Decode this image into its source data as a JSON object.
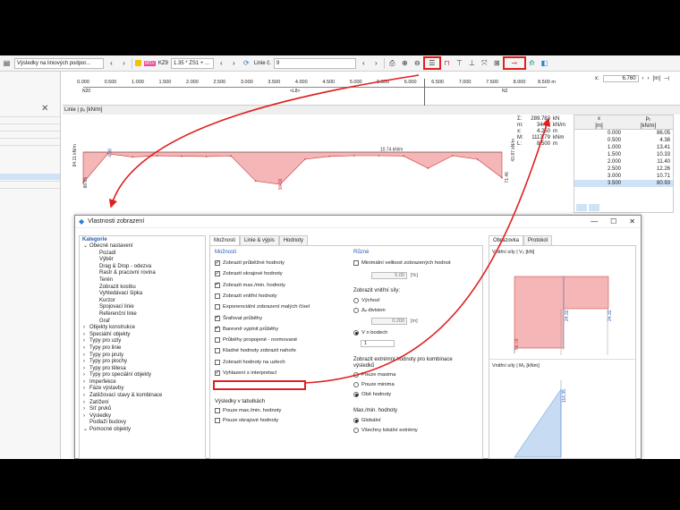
{
  "toolbar": {
    "results_combo": "Výsledky na liniových podpor...",
    "co_label": "MSV",
    "co_code": "KZ9",
    "co_value": "1.35 * ZS1 + ...",
    "line_label": "Linie č.",
    "line_value": "9"
  },
  "ruler": {
    "ticks": [
      "0.000",
      "0.500",
      "1.000",
      "1.500",
      "2.000",
      "2.500",
      "3.000",
      "3.500",
      "4.000",
      "4.500",
      "5.000",
      "5.500",
      "6.000",
      "6.500",
      "7.000",
      "7.500",
      "8.000",
      "8.500 m"
    ],
    "node_start": "N20",
    "node_end": "N2",
    "length_label": "<L8>",
    "x_label": "x:",
    "x_value": "6.760",
    "x_unit": "[m]"
  },
  "diagram_title": "Linie | p₂ [kN/m]",
  "summary": {
    "rows": [
      {
        "label": "Σ:",
        "value": "289.783",
        "unit": "kN"
      },
      {
        "label": "m:",
        "value": "34.09",
        "unit": "kN/m"
      },
      {
        "label": "x:",
        "value": "4.250",
        "unit": "m"
      },
      {
        "label": "M:",
        "value": "1117.79",
        "unit": "kNm"
      },
      {
        "label": "L:",
        "value": "8.500",
        "unit": "m"
      }
    ]
  },
  "value_table": {
    "col1_head": "x",
    "col1_unit": "[m]",
    "col2_head": "p₂",
    "col2_unit": "[kN/m]",
    "rows": [
      {
        "x": "0.000",
        "p": "86.05"
      },
      {
        "x": "0.500",
        "p": "4.38"
      },
      {
        "x": "1.000",
        "p": "13.41"
      },
      {
        "x": "1.500",
        "p": "10.33"
      },
      {
        "x": "2.000",
        "p": "11.40"
      },
      {
        "x": "2.500",
        "p": "12.26"
      },
      {
        "x": "3.000",
        "p": "10.71"
      },
      {
        "x": "3.500",
        "p": "80.93"
      }
    ]
  },
  "chart_data": {
    "type": "area",
    "title": "Linie | p₂ [kN/m]",
    "xlabel": "",
    "ylabel": "",
    "x": [
      0.0,
      0.5,
      1.0,
      1.5,
      2.0,
      2.5,
      3.0,
      3.5,
      4.0,
      4.5,
      5.0,
      5.5,
      6.0,
      6.5,
      7.0,
      7.5,
      8.0,
      8.5
    ],
    "series": [
      {
        "values": [
          86.05,
          4.38,
          13.41,
          10.33,
          11.4,
          12.26,
          10.71,
          80.93,
          90.36,
          20.0,
          12.0,
          10.0,
          10.0,
          10.74,
          45.0,
          10.0,
          20.0,
          71.46
        ]
      }
    ],
    "annotations": [
      "84.11 kN/m",
      "86.05",
      "4.38",
      "90.36",
      "10.74 kN/m",
      "43.87 kN/m",
      "71.46"
    ],
    "xlim": [
      0,
      8.5
    ]
  },
  "dialog": {
    "title": "Vlastnosti zobrazení",
    "category_header": "Kategorie",
    "categories": [
      {
        "label": "Obecné nastavení",
        "level": 0,
        "exp": "⌄"
      },
      {
        "label": "Pozadí",
        "level": 2
      },
      {
        "label": "Výběr",
        "level": 2
      },
      {
        "label": "Drag & Drop - odezva",
        "level": 2
      },
      {
        "label": "Rastr & pracovní rovina",
        "level": 2
      },
      {
        "label": "Terén",
        "level": 2
      },
      {
        "label": "Zobrazit kostku",
        "level": 2
      },
      {
        "label": "Vyhledávací šipka",
        "level": 2
      },
      {
        "label": "Kurzor",
        "level": 2
      },
      {
        "label": "Spojovací linie",
        "level": 2
      },
      {
        "label": "Referenční linie",
        "level": 2
      },
      {
        "label": "Graf",
        "level": 2
      },
      {
        "label": "Objekty konstrukce",
        "level": 0,
        "exp": "›"
      },
      {
        "label": "Speciální objekty",
        "level": 0,
        "exp": "›"
      },
      {
        "label": "Typy pro uzly",
        "level": 0,
        "exp": "›"
      },
      {
        "label": "Typy pro linie",
        "level": 0,
        "exp": "›"
      },
      {
        "label": "Typy pro pruty",
        "level": 0,
        "exp": "›"
      },
      {
        "label": "Typy pro plochy",
        "level": 0,
        "exp": "›"
      },
      {
        "label": "Typy pro tělesa",
        "level": 0,
        "exp": "›"
      },
      {
        "label": "Typy pro speciální objekty",
        "level": 0,
        "exp": "›"
      },
      {
        "label": "Imperfekce",
        "level": 0,
        "exp": "›"
      },
      {
        "label": "Fáze výstavby",
        "level": 0,
        "exp": "›"
      },
      {
        "label": "Zatěžovací stavy & kombinace",
        "level": 0,
        "exp": "›"
      },
      {
        "label": "Zatížení",
        "level": 0,
        "exp": "›"
      },
      {
        "label": "Síť prvků",
        "level": 0,
        "exp": "›"
      },
      {
        "label": "Výsledky",
        "level": 0,
        "exp": "›"
      },
      {
        "label": "Podlaží budovy",
        "level": 0,
        "exp": ""
      },
      {
        "label": "Pomocné objekty",
        "level": 0,
        "exp": "⌄"
      }
    ],
    "tabs": [
      "Možnosti",
      "Linie & výpis",
      "Hodnoty"
    ],
    "options_title": "Možnosti",
    "options": [
      {
        "label": "Zobrazit průběžné hodnoty",
        "checked": "✓"
      },
      {
        "label": "Zobrazit okrajové hodnoty",
        "checked": "✓"
      },
      {
        "label": "Zobrazit max./min. hodnoty",
        "checked": "✓"
      },
      {
        "label": "Zobrazit vnitřní hodnoty",
        "checked": ""
      },
      {
        "label": "Exponenciální zobrazení malých čísel",
        "checked": ""
      },
      {
        "label": "Šrafovat průběhy",
        "checked": "✓"
      },
      {
        "label": "Barevně vyplnit průběhy",
        "checked": "✓"
      },
      {
        "label": "Průběhy propojené - normované",
        "checked": ""
      },
      {
        "label": "Kladné hodnoty zobrazit nahoře",
        "checked": ""
      },
      {
        "label": "Zobrazit hodnoty na uzlech",
        "checked": ""
      },
      {
        "label": "Vyhlazení s interpretací",
        "checked": "✓"
      }
    ],
    "results_title": "Výsledky v tabulkách",
    "results_opts": [
      {
        "label": "Pouze max./min. hodnoty",
        "checked": ""
      },
      {
        "label": "Pouze okrajové hodnoty",
        "checked": ""
      }
    ],
    "misc_title": "Různé",
    "min_size_label": "Minimální velikost zobrazených hodnot",
    "min_size_value": "5.00",
    "min_size_unit": "[%]",
    "internal_title": "Zobrazit vnitřní síly:",
    "internal_default": "Výchozí",
    "internal_division": "Δₓ division",
    "division_value": "0.200",
    "division_unit": "[m]",
    "in_points": "V n bodech",
    "points_value": "1",
    "extreme_title": "Zobrazit extrémní hodnoty pro kombinace výsledků",
    "extreme_max": "Pouze maxima",
    "extreme_min": "Pouze minima",
    "extreme_both": "Obě hodnoty",
    "maxmin_title": "Max./min. hodnoty",
    "maxmin_global": "Globální",
    "maxmin_all": "Všechny lokální extrémy",
    "preview_tabs": [
      "Obrázovka",
      "Protokol"
    ],
    "preview_label1": "Vnitřní síly | V₂ [kN]",
    "preview_label2": "Vnitřní síly | M₂ [kNm]",
    "preview_values": [
      "56.79",
      "24.32",
      "24.32",
      "116.35"
    ]
  }
}
